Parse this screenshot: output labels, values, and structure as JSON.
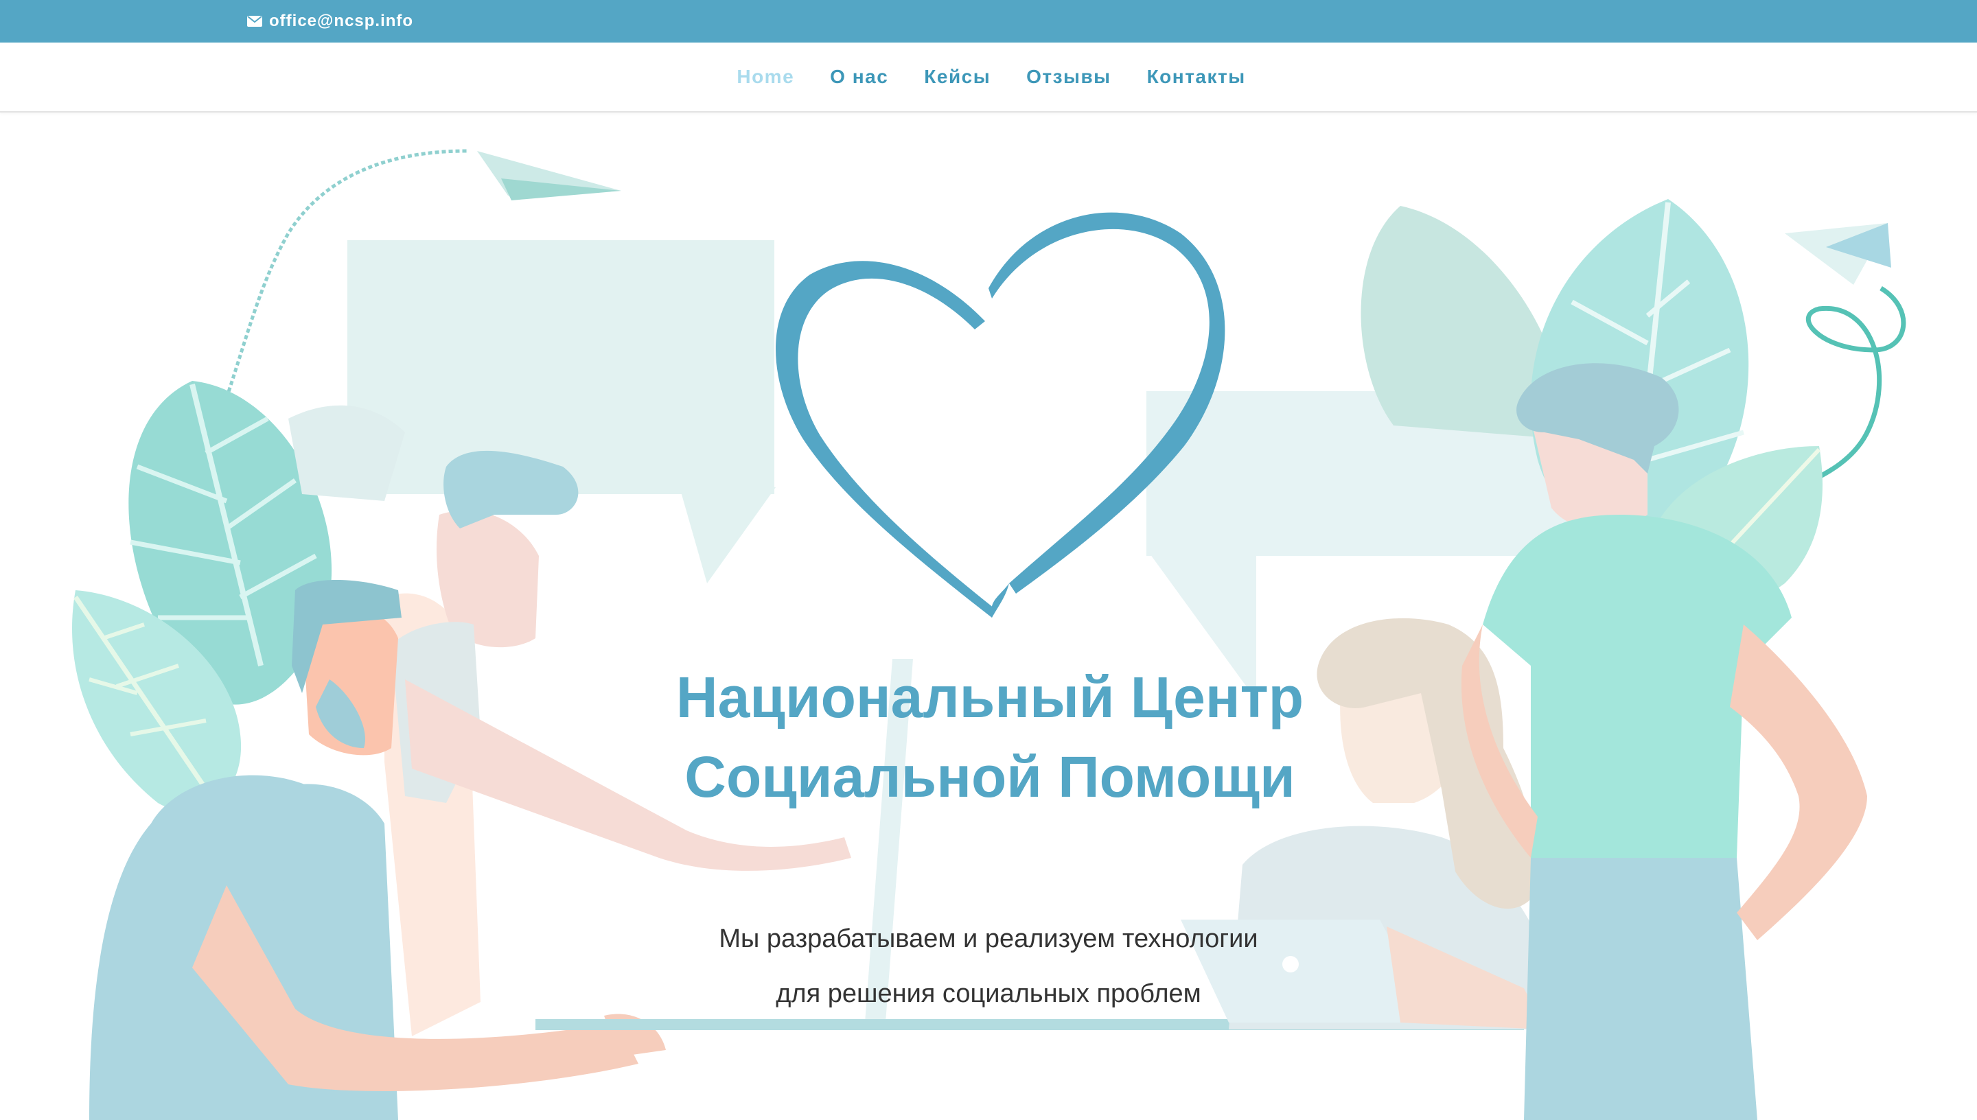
{
  "topbar": {
    "email_icon": "envelope-icon",
    "email": "office@ncsp.info",
    "bar_color": "#54a6c5"
  },
  "nav": {
    "items": [
      {
        "label": "Home",
        "active": true
      },
      {
        "label": "О нас",
        "active": false
      },
      {
        "label": "Кейсы",
        "active": false
      },
      {
        "label": "Отзывы",
        "active": false
      },
      {
        "label": "Контакты",
        "active": false
      }
    ],
    "link_color": "#3d97b8",
    "active_color": "#a9dbed"
  },
  "hero": {
    "title_line1": "Национальный Центр",
    "title_line2": "Социальной Помощи",
    "subtitle_line1": "Мы разрабатываем и реализуем технологии",
    "subtitle_line2": "для решения социальных проблем",
    "title_color": "#54a6c5",
    "illustration": {
      "elements": [
        "heart-logo",
        "paper-plane-icon",
        "paper-plane-icon",
        "speech-bubble",
        "speech-bubble",
        "leaf",
        "leaf",
        "people-at-desk"
      ]
    }
  }
}
